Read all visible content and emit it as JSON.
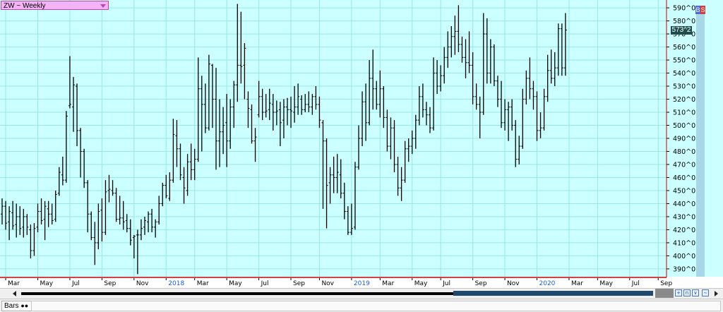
{
  "symbol": {
    "label": "ZW ~ Weekly"
  },
  "buttons": {
    "b": "B",
    "s": "S"
  },
  "last_price": {
    "label": "573^2"
  },
  "status": {
    "tab_label": "Bars"
  },
  "colors": {
    "plot_background": "#ccffff",
    "grid": "#99e6e6",
    "bar": "#000000",
    "axis_red": "#cc0000",
    "year_label": "#1a5ce6",
    "month_label": "#000000"
  },
  "chart_data": {
    "type": "ohlc",
    "ylim": [
      384,
      596
    ],
    "grid": true,
    "y_ticks": [
      {
        "value": 390,
        "label": "390^0"
      },
      {
        "value": 400,
        "label": "400^0"
      },
      {
        "value": 410,
        "label": "410^0"
      },
      {
        "value": 420,
        "label": "420^0"
      },
      {
        "value": 430,
        "label": "430^0"
      },
      {
        "value": 440,
        "label": "440^0"
      },
      {
        "value": 450,
        "label": "450^0"
      },
      {
        "value": 460,
        "label": "460^0"
      },
      {
        "value": 470,
        "label": "470^0"
      },
      {
        "value": 480,
        "label": "480^0"
      },
      {
        "value": 490,
        "label": "490^0"
      },
      {
        "value": 500,
        "label": "500^0"
      },
      {
        "value": 510,
        "label": "510^0"
      },
      {
        "value": 520,
        "label": "520^0"
      },
      {
        "value": 530,
        "label": "530^0"
      },
      {
        "value": 540,
        "label": "540^0"
      },
      {
        "value": 550,
        "label": "550^0"
      },
      {
        "value": 560,
        "label": "560^0"
      },
      {
        "value": 570,
        "label": "570^0"
      },
      {
        "value": 580,
        "label": "580^0"
      },
      {
        "value": 590,
        "label": "590^0"
      }
    ],
    "x_ticks": [
      {
        "bar": 1,
        "label": "Mar",
        "year": false
      },
      {
        "bar": 10,
        "label": "May",
        "year": false
      },
      {
        "bar": 19,
        "label": "Jul",
        "year": false
      },
      {
        "bar": 28,
        "label": "Sep",
        "year": false
      },
      {
        "bar": 37,
        "label": "Nov",
        "year": false
      },
      {
        "bar": 46,
        "label": "2018",
        "year": true
      },
      {
        "bar": 54,
        "label": "Mar",
        "year": false
      },
      {
        "bar": 63,
        "label": "May",
        "year": false
      },
      {
        "bar": 72,
        "label": "Jul",
        "year": false
      },
      {
        "bar": 81,
        "label": "Sep",
        "year": false
      },
      {
        "bar": 89,
        "label": "Nov",
        "year": false
      },
      {
        "bar": 98,
        "label": "2019",
        "year": true
      },
      {
        "bar": 106,
        "label": "Mar",
        "year": false
      },
      {
        "bar": 115,
        "label": "May",
        "year": false
      },
      {
        "bar": 123,
        "label": "Jul",
        "year": false
      },
      {
        "bar": 132,
        "label": "Sep",
        "year": false
      },
      {
        "bar": 141,
        "label": "Nov",
        "year": false
      },
      {
        "bar": 150,
        "label": "2020",
        "year": true
      },
      {
        "bar": 159,
        "label": "Mar",
        "year": false
      },
      {
        "bar": 167,
        "label": "May",
        "year": false
      },
      {
        "bar": 176,
        "label": "Jul",
        "year": false
      },
      {
        "bar": 184,
        "label": "Sep",
        "year": false
      }
    ],
    "bars": [
      {
        "o": 432,
        "h": 444,
        "l": 424,
        "c": 438
      },
      {
        "o": 438,
        "h": 442,
        "l": 420,
        "c": 425
      },
      {
        "o": 426,
        "h": 438,
        "l": 412,
        "c": 434
      },
      {
        "o": 433,
        "h": 442,
        "l": 420,
        "c": 423
      },
      {
        "o": 424,
        "h": 440,
        "l": 414,
        "c": 430
      },
      {
        "o": 430,
        "h": 438,
        "l": 416,
        "c": 421
      },
      {
        "o": 422,
        "h": 436,
        "l": 414,
        "c": 430
      },
      {
        "o": 430,
        "h": 432,
        "l": 416,
        "c": 422
      },
      {
        "o": 420,
        "h": 424,
        "l": 398,
        "c": 404
      },
      {
        "o": 404,
        "h": 425,
        "l": 400,
        "c": 421
      },
      {
        "o": 422,
        "h": 440,
        "l": 418,
        "c": 434
      },
      {
        "o": 434,
        "h": 444,
        "l": 424,
        "c": 427
      },
      {
        "o": 428,
        "h": 442,
        "l": 412,
        "c": 438
      },
      {
        "o": 436,
        "h": 442,
        "l": 422,
        "c": 432
      },
      {
        "o": 432,
        "h": 440,
        "l": 424,
        "c": 427
      },
      {
        "o": 428,
        "h": 450,
        "l": 426,
        "c": 447
      },
      {
        "o": 448,
        "h": 468,
        "l": 446,
        "c": 464
      },
      {
        "o": 462,
        "h": 476,
        "l": 454,
        "c": 458
      },
      {
        "o": 458,
        "h": 511,
        "l": 456,
        "c": 507
      },
      {
        "o": 515,
        "h": 553,
        "l": 513,
        "c": 516
      },
      {
        "o": 514,
        "h": 537,
        "l": 495,
        "c": 531
      },
      {
        "o": 530,
        "h": 532,
        "l": 484,
        "c": 496
      },
      {
        "o": 496,
        "h": 498,
        "l": 460,
        "c": 480
      },
      {
        "o": 480,
        "h": 482,
        "l": 452,
        "c": 456
      },
      {
        "o": 456,
        "h": 458,
        "l": 418,
        "c": 432
      },
      {
        "o": 432,
        "h": 434,
        "l": 412,
        "c": 414
      },
      {
        "o": 414,
        "h": 426,
        "l": 393,
        "c": 410
      },
      {
        "o": 410,
        "h": 440,
        "l": 405,
        "c": 434
      },
      {
        "o": 435,
        "h": 444,
        "l": 411,
        "c": 418
      },
      {
        "o": 418,
        "h": 458,
        "l": 416,
        "c": 449
      },
      {
        "o": 450,
        "h": 462,
        "l": 441,
        "c": 451
      },
      {
        "o": 450,
        "h": 458,
        "l": 446,
        "c": 448
      },
      {
        "o": 448,
        "h": 452,
        "l": 426,
        "c": 428
      },
      {
        "o": 428,
        "h": 446,
        "l": 424,
        "c": 429
      },
      {
        "o": 429,
        "h": 442,
        "l": 420,
        "c": 426
      },
      {
        "o": 427,
        "h": 432,
        "l": 418,
        "c": 421
      },
      {
        "o": 421,
        "h": 428,
        "l": 408,
        "c": 412
      },
      {
        "o": 414,
        "h": 416,
        "l": 398,
        "c": 415
      },
      {
        "o": 416,
        "h": 420,
        "l": 386,
        "c": 416
      },
      {
        "o": 416,
        "h": 428,
        "l": 412,
        "c": 421
      },
      {
        "o": 422,
        "h": 430,
        "l": 416,
        "c": 427
      },
      {
        "o": 426,
        "h": 434,
        "l": 418,
        "c": 432
      },
      {
        "o": 432,
        "h": 436,
        "l": 418,
        "c": 422
      },
      {
        "o": 422,
        "h": 428,
        "l": 414,
        "c": 426
      },
      {
        "o": 426,
        "h": 446,
        "l": 424,
        "c": 440
      },
      {
        "o": 440,
        "h": 456,
        "l": 438,
        "c": 454
      },
      {
        "o": 454,
        "h": 462,
        "l": 444,
        "c": 446
      },
      {
        "o": 444,
        "h": 464,
        "l": 442,
        "c": 458
      },
      {
        "o": 458,
        "h": 505,
        "l": 456,
        "c": 493
      },
      {
        "o": 492,
        "h": 504,
        "l": 468,
        "c": 482
      },
      {
        "o": 482,
        "h": 486,
        "l": 458,
        "c": 462
      },
      {
        "o": 460,
        "h": 468,
        "l": 440,
        "c": 452
      },
      {
        "o": 450,
        "h": 478,
        "l": 446,
        "c": 472
      },
      {
        "o": 472,
        "h": 486,
        "l": 458,
        "c": 466
      },
      {
        "o": 466,
        "h": 482,
        "l": 458,
        "c": 474
      },
      {
        "o": 474,
        "h": 552,
        "l": 472,
        "c": 528
      },
      {
        "o": 528,
        "h": 538,
        "l": 480,
        "c": 516
      },
      {
        "o": 516,
        "h": 532,
        "l": 494,
        "c": 498
      },
      {
        "o": 498,
        "h": 554,
        "l": 496,
        "c": 547
      },
      {
        "o": 546,
        "h": 547,
        "l": 498,
        "c": 520
      },
      {
        "o": 520,
        "h": 544,
        "l": 466,
        "c": 488
      },
      {
        "o": 488,
        "h": 520,
        "l": 468,
        "c": 495
      },
      {
        "o": 495,
        "h": 514,
        "l": 478,
        "c": 500
      },
      {
        "o": 502,
        "h": 524,
        "l": 468,
        "c": 488
      },
      {
        "o": 488,
        "h": 520,
        "l": 482,
        "c": 514
      },
      {
        "o": 514,
        "h": 534,
        "l": 498,
        "c": 531
      },
      {
        "o": 531,
        "h": 593,
        "l": 518,
        "c": 546
      },
      {
        "o": 546,
        "h": 587,
        "l": 532,
        "c": 545
      },
      {
        "o": 546,
        "h": 563,
        "l": 520,
        "c": 559
      },
      {
        "o": 520,
        "h": 526,
        "l": 498,
        "c": 513
      },
      {
        "o": 512,
        "h": 516,
        "l": 486,
        "c": 488
      },
      {
        "o": 488,
        "h": 498,
        "l": 472,
        "c": 491
      },
      {
        "o": 508,
        "h": 534,
        "l": 506,
        "c": 522
      },
      {
        "o": 522,
        "h": 528,
        "l": 504,
        "c": 510
      },
      {
        "o": 510,
        "h": 524,
        "l": 506,
        "c": 511
      },
      {
        "o": 512,
        "h": 528,
        "l": 504,
        "c": 517
      },
      {
        "o": 516,
        "h": 524,
        "l": 496,
        "c": 510
      },
      {
        "o": 510,
        "h": 519,
        "l": 500,
        "c": 511
      },
      {
        "o": 512,
        "h": 518,
        "l": 484,
        "c": 502
      },
      {
        "o": 504,
        "h": 520,
        "l": 490,
        "c": 514
      },
      {
        "o": 514,
        "h": 521,
        "l": 500,
        "c": 512
      },
      {
        "o": 512,
        "h": 522,
        "l": 498,
        "c": 511
      },
      {
        "o": 510,
        "h": 530,
        "l": 502,
        "c": 514
      },
      {
        "o": 514,
        "h": 532,
        "l": 508,
        "c": 522
      },
      {
        "o": 520,
        "h": 523,
        "l": 508,
        "c": 512
      },
      {
        "o": 512,
        "h": 524,
        "l": 510,
        "c": 516
      },
      {
        "o": 516,
        "h": 526,
        "l": 510,
        "c": 514
      },
      {
        "o": 514,
        "h": 524,
        "l": 508,
        "c": 522
      },
      {
        "o": 522,
        "h": 530,
        "l": 512,
        "c": 516
      },
      {
        "o": 516,
        "h": 522,
        "l": 498,
        "c": 504
      },
      {
        "o": 502,
        "h": 504,
        "l": 436,
        "c": 488
      },
      {
        "o": 488,
        "h": 490,
        "l": 421,
        "c": 454
      },
      {
        "o": 456,
        "h": 468,
        "l": 440,
        "c": 462
      },
      {
        "o": 462,
        "h": 476,
        "l": 448,
        "c": 460
      },
      {
        "o": 460,
        "h": 478,
        "l": 448,
        "c": 464
      },
      {
        "o": 462,
        "h": 474,
        "l": 444,
        "c": 448
      },
      {
        "o": 448,
        "h": 456,
        "l": 428,
        "c": 434
      },
      {
        "o": 434,
        "h": 438,
        "l": 416,
        "c": 418
      },
      {
        "o": 418,
        "h": 440,
        "l": 416,
        "c": 421
      },
      {
        "o": 422,
        "h": 472,
        "l": 420,
        "c": 468
      },
      {
        "o": 468,
        "h": 500,
        "l": 466,
        "c": 490
      },
      {
        "o": 490,
        "h": 526,
        "l": 484,
        "c": 518
      },
      {
        "o": 518,
        "h": 532,
        "l": 488,
        "c": 502
      },
      {
        "o": 502,
        "h": 550,
        "l": 500,
        "c": 536
      },
      {
        "o": 536,
        "h": 558,
        "l": 512,
        "c": 528
      },
      {
        "o": 528,
        "h": 534,
        "l": 512,
        "c": 516
      },
      {
        "o": 516,
        "h": 542,
        "l": 506,
        "c": 528
      },
      {
        "o": 528,
        "h": 530,
        "l": 498,
        "c": 506
      },
      {
        "o": 506,
        "h": 512,
        "l": 480,
        "c": 484
      },
      {
        "o": 484,
        "h": 506,
        "l": 474,
        "c": 498
      },
      {
        "o": 498,
        "h": 504,
        "l": 464,
        "c": 470
      },
      {
        "o": 470,
        "h": 476,
        "l": 446,
        "c": 452
      },
      {
        "o": 452,
        "h": 468,
        "l": 442,
        "c": 458
      },
      {
        "o": 458,
        "h": 488,
        "l": 456,
        "c": 482
      },
      {
        "o": 482,
        "h": 490,
        "l": 472,
        "c": 484
      },
      {
        "o": 484,
        "h": 496,
        "l": 478,
        "c": 490
      },
      {
        "o": 490,
        "h": 508,
        "l": 482,
        "c": 504
      },
      {
        "o": 504,
        "h": 530,
        "l": 500,
        "c": 522
      },
      {
        "o": 522,
        "h": 532,
        "l": 506,
        "c": 512
      },
      {
        "o": 512,
        "h": 518,
        "l": 500,
        "c": 508
      },
      {
        "o": 508,
        "h": 514,
        "l": 494,
        "c": 498
      },
      {
        "o": 498,
        "h": 552,
        "l": 496,
        "c": 540
      },
      {
        "o": 540,
        "h": 550,
        "l": 524,
        "c": 530
      },
      {
        "o": 530,
        "h": 546,
        "l": 526,
        "c": 538
      },
      {
        "o": 538,
        "h": 560,
        "l": 532,
        "c": 552
      },
      {
        "o": 552,
        "h": 572,
        "l": 544,
        "c": 560
      },
      {
        "o": 560,
        "h": 576,
        "l": 552,
        "c": 568
      },
      {
        "o": 568,
        "h": 584,
        "l": 554,
        "c": 572
      },
      {
        "o": 572,
        "h": 592,
        "l": 556,
        "c": 562
      },
      {
        "o": 562,
        "h": 568,
        "l": 548,
        "c": 552
      },
      {
        "o": 552,
        "h": 566,
        "l": 536,
        "c": 548
      },
      {
        "o": 548,
        "h": 572,
        "l": 540,
        "c": 546
      },
      {
        "o": 546,
        "h": 556,
        "l": 516,
        "c": 522
      },
      {
        "o": 522,
        "h": 532,
        "l": 512,
        "c": 516
      },
      {
        "o": 516,
        "h": 522,
        "l": 490,
        "c": 510
      },
      {
        "o": 510,
        "h": 586,
        "l": 508,
        "c": 570
      },
      {
        "o": 570,
        "h": 582,
        "l": 532,
        "c": 540
      },
      {
        "o": 540,
        "h": 566,
        "l": 532,
        "c": 560
      },
      {
        "o": 560,
        "h": 562,
        "l": 530,
        "c": 534
      },
      {
        "o": 534,
        "h": 538,
        "l": 514,
        "c": 520
      },
      {
        "o": 520,
        "h": 534,
        "l": 498,
        "c": 502
      },
      {
        "o": 502,
        "h": 520,
        "l": 496,
        "c": 512
      },
      {
        "o": 512,
        "h": 518,
        "l": 488,
        "c": 514
      },
      {
        "o": 514,
        "h": 520,
        "l": 496,
        "c": 500
      },
      {
        "o": 500,
        "h": 504,
        "l": 468,
        "c": 474
      },
      {
        "o": 474,
        "h": 492,
        "l": 470,
        "c": 484
      },
      {
        "o": 484,
        "h": 528,
        "l": 482,
        "c": 520
      },
      {
        "o": 520,
        "h": 542,
        "l": 516,
        "c": 536
      },
      {
        "o": 536,
        "h": 552,
        "l": 520,
        "c": 528
      },
      {
        "o": 528,
        "h": 534,
        "l": 512,
        "c": 522
      },
      {
        "o": 522,
        "h": 526,
        "l": 488,
        "c": 496
      },
      {
        "o": 496,
        "h": 510,
        "l": 490,
        "c": 498
      },
      {
        "o": 498,
        "h": 528,
        "l": 496,
        "c": 522
      },
      {
        "o": 522,
        "h": 554,
        "l": 518,
        "c": 542
      },
      {
        "o": 542,
        "h": 558,
        "l": 532,
        "c": 536
      },
      {
        "o": 536,
        "h": 556,
        "l": 530,
        "c": 544
      },
      {
        "o": 544,
        "h": 578,
        "l": 538,
        "c": 574
      },
      {
        "o": 574,
        "h": 578,
        "l": 538,
        "c": 544
      },
      {
        "o": 544,
        "h": 586,
        "l": 538,
        "c": 573
      }
    ]
  }
}
